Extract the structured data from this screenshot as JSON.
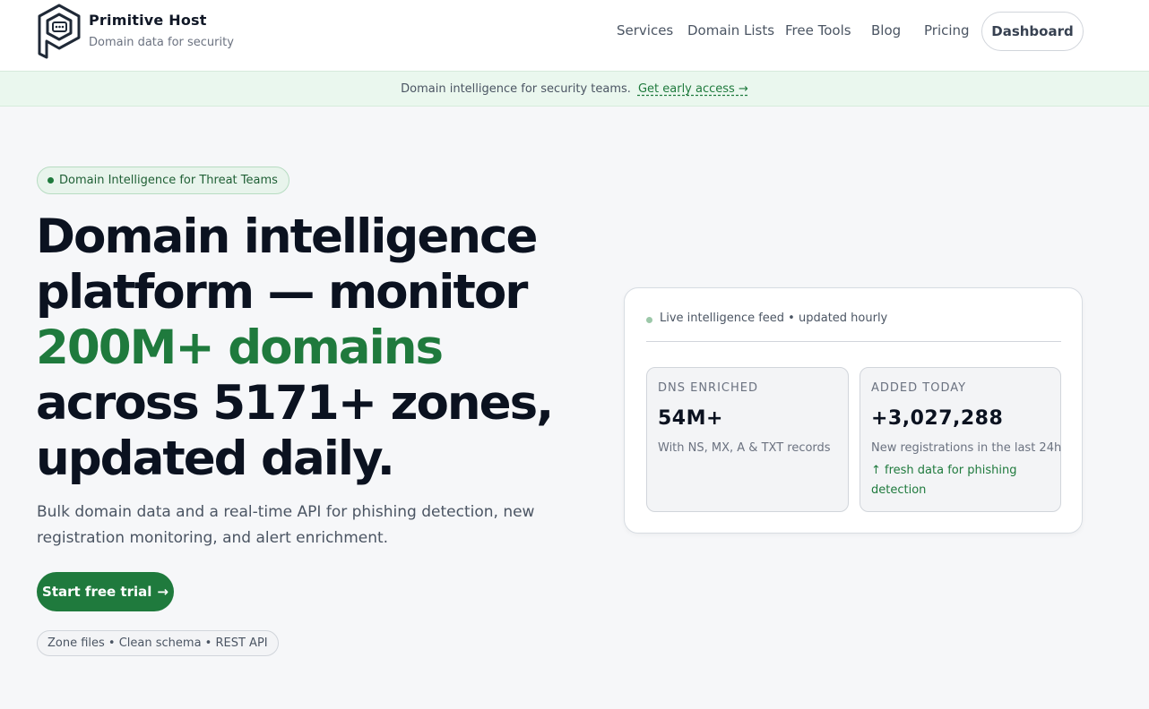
{
  "brand": {
    "name": "Primitive Host",
    "tagline": "Domain data for security"
  },
  "nav": {
    "links": [
      "Services",
      "Domain Lists",
      "Free Tools",
      "Blog",
      "Pricing"
    ],
    "dashboard_label": "Dashboard"
  },
  "banner": {
    "text": "Domain intelligence for security teams.",
    "link_label": "Get early access →"
  },
  "hero": {
    "pill_label": "Domain Intelligence for Threat Teams",
    "headline_part1": "Domain intelligence platform — monitor",
    "headline_accent": "200M+ domains",
    "headline_part2": "across 5171+ zones, updated daily.",
    "subtext": "Bulk domain data and a real-time API for phishing detection, new registration monitoring, and alert enrichment.",
    "cta_label": "Start free trial",
    "cta_arrow": "→",
    "features": "Zone files • Clean schema • REST API"
  },
  "card": {
    "feed_label": "Live intelligence feed • updated hourly",
    "stats": [
      {
        "label": "DNS ENRICHED",
        "value": "54M+",
        "note": "With NS, MX, A & TXT records"
      },
      {
        "label": "ADDED TODAY",
        "value": "+3,027,288",
        "note": "New registrations in the last 24h",
        "trend": "↑ fresh data for phishing detection"
      }
    ]
  },
  "colors": {
    "accent": "#1f7a3d",
    "banner_bg": "#eaf7ee",
    "page_bg": "#f6f7f9"
  }
}
